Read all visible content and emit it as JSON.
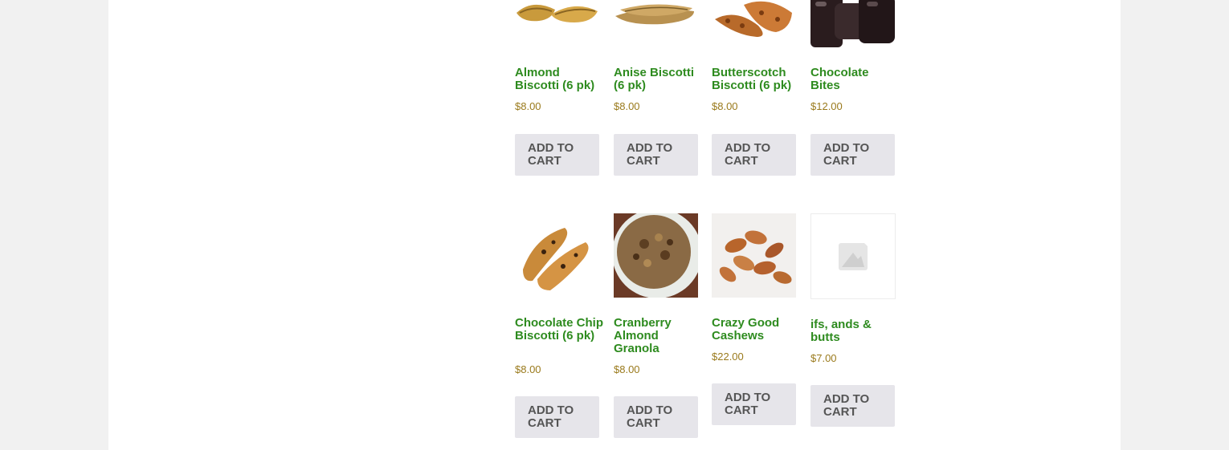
{
  "products": [
    {
      "name": "Almond Biscotti (6 pk)",
      "price": "$8.00",
      "button": "ADD TO CART",
      "image": "almond-biscotti-image"
    },
    {
      "name": "Anise Biscotti (6 pk)",
      "price": "$8.00",
      "button": "ADD TO CART",
      "image": "anise-biscotti-image"
    },
    {
      "name": "Butterscotch Biscotti (6 pk)",
      "price": "$8.00",
      "button": "ADD TO CART",
      "image": "butterscotch-biscotti-image"
    },
    {
      "name": "Chocolate Bites",
      "price": "$12.00",
      "button": "ADD TO CART",
      "image": "chocolate-bites-image"
    },
    {
      "name": "Chocolate Chip Biscotti (6 pk)",
      "price": "$8.00",
      "button": "ADD TO CART",
      "image": "chocolate-chip-biscotti-image"
    },
    {
      "name": "Cranberry Almond Granola",
      "price": "$8.00",
      "button": "ADD TO CART",
      "image": "granola-bowl-image"
    },
    {
      "name": "Crazy Good Cashews",
      "price": "$22.00",
      "button": "ADD TO CART",
      "image": "cashews-image"
    },
    {
      "name": "ifs, ands & butts",
      "price": "$7.00",
      "button": "ADD TO CART",
      "image": "placeholder-image"
    }
  ],
  "colors": {
    "title_green": "#2e8b1f",
    "price_gold": "#9a7a1c",
    "button_bg": "#e6e5ea",
    "button_text": "#555555",
    "page_bg": "#f1f1f1"
  }
}
